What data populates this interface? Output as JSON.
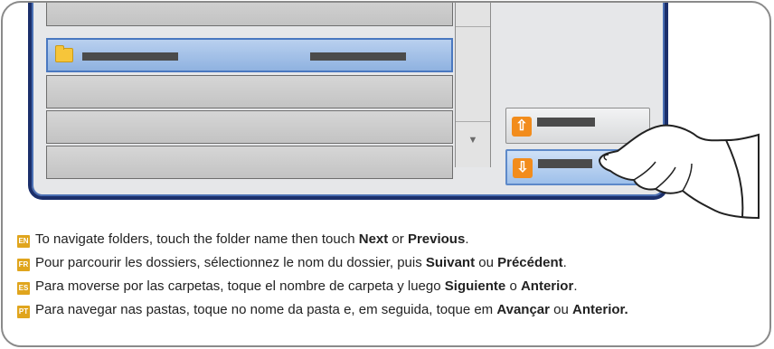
{
  "nav_buttons": {
    "up_icon": "arrow-up-icon",
    "down_icon": "arrow-down-icon",
    "accent": "#f28c1c"
  },
  "scroll": {
    "down_glyph": "▼"
  },
  "instructions": [
    {
      "lang": "EN",
      "pre": "To navigate folders, touch the folder name then touch ",
      "b1": "Next",
      "mid": " or ",
      "b2": "Previous",
      "post": "."
    },
    {
      "lang": "FR",
      "pre": "Pour parcourir les dossiers, sélectionnez le nom du dossier, puis ",
      "b1": "Suivant",
      "mid": " ou ",
      "b2": "Précédent",
      "post": "."
    },
    {
      "lang": "ES",
      "pre": "Para moverse por las carpetas, toque el nombre de carpeta y luego ",
      "b1": "Siguiente",
      "mid": " o ",
      "b2": "Anterior",
      "post": "."
    },
    {
      "lang": "PT",
      "pre": "Para navegar nas pastas, toque no nome da pasta e, em seguida, toque em ",
      "b1": "Avançar",
      "mid": " ou ",
      "b2": "Anterior.",
      "post": ""
    }
  ]
}
